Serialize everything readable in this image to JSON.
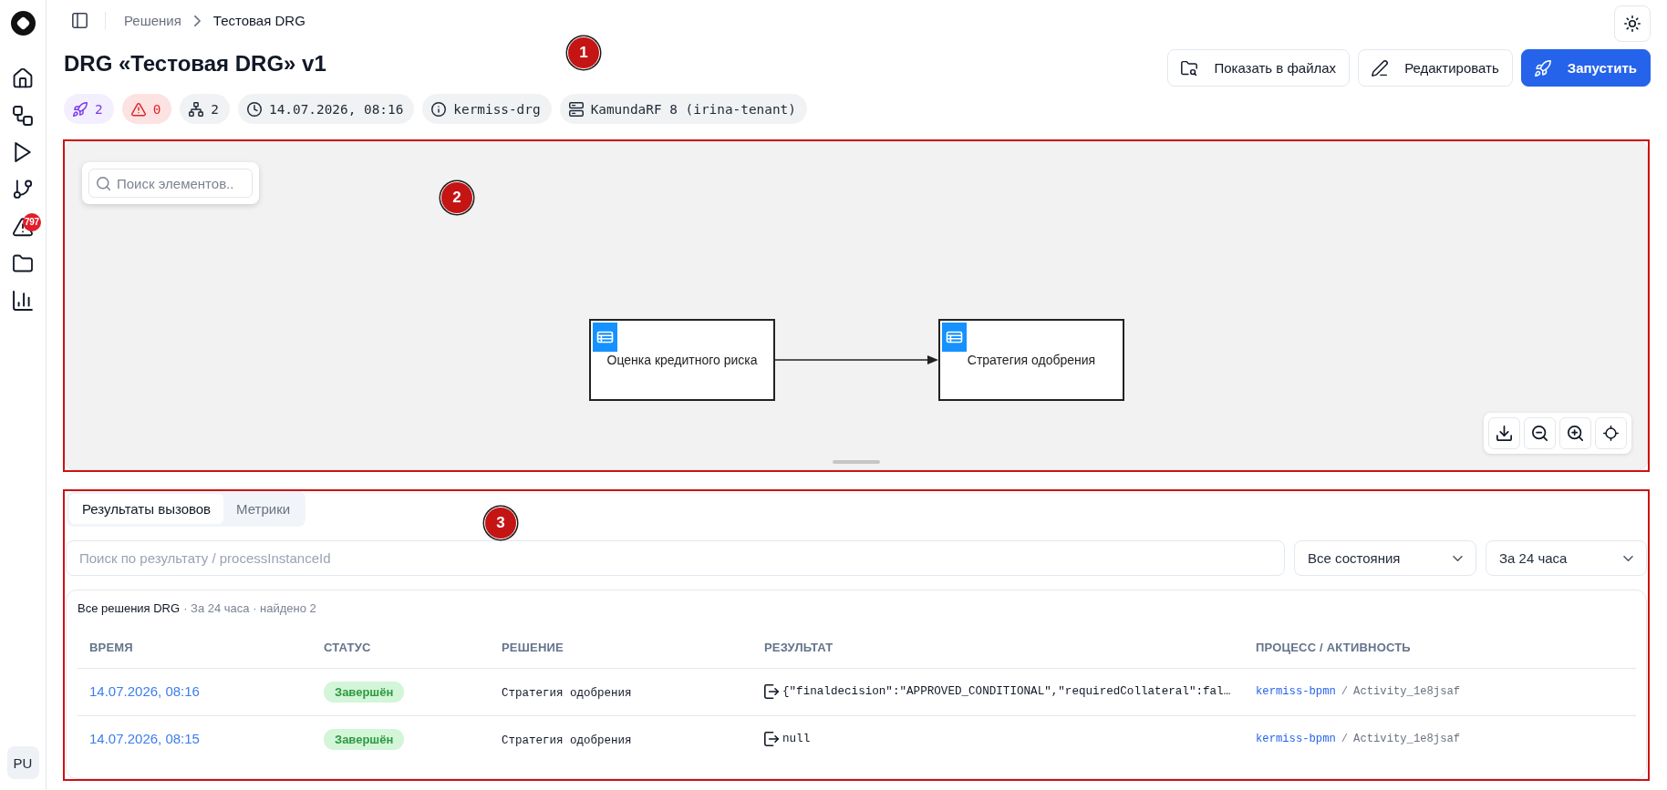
{
  "sidebar": {
    "items": [
      {
        "kind": "home",
        "selected": false
      },
      {
        "kind": "flows",
        "selected": false
      },
      {
        "kind": "run",
        "selected": false
      },
      {
        "kind": "branches",
        "selected": false
      },
      {
        "kind": "alerts",
        "selected": false,
        "badge": "797"
      },
      {
        "kind": "files",
        "selected": false
      },
      {
        "kind": "stats",
        "selected": false
      }
    ],
    "user": {
      "initials": "PU"
    }
  },
  "breadcrumb": [
    {
      "label": "Решения",
      "current": false
    },
    {
      "label": "Тестовая DRG",
      "current": true
    }
  ],
  "header": {
    "marker": "1",
    "title": "DRG «Тестовая DRG» v1",
    "actions": [
      {
        "kind": "files",
        "label": "Показать в файлах",
        "primary": false
      },
      {
        "kind": "edit",
        "label": "Редактировать",
        "primary": false
      },
      {
        "kind": "launch",
        "label": "Запустить",
        "primary": true
      }
    ],
    "chips": [
      {
        "kind": "launches",
        "text": "2"
      },
      {
        "kind": "errors",
        "text": "0"
      },
      {
        "kind": "nodes",
        "text": "2"
      },
      {
        "kind": "date",
        "text": "14.07.2026, 08:16"
      },
      {
        "kind": "key",
        "text": "kermiss-drg"
      },
      {
        "kind": "engine",
        "text": "KamundaRF 8 (irina-tenant)"
      }
    ]
  },
  "canvas": {
    "framed": true,
    "marker": "2",
    "search": {
      "placeholder": "Поиск элементов.."
    },
    "nodes": [
      {
        "label": "Оценка кредитного риска",
        "outgoing": true
      },
      {
        "label": "Стратегия одобрения",
        "outgoing": false
      }
    ]
  },
  "results": {
    "framed": true,
    "marker": "3",
    "tabs": [
      {
        "label": "Результаты вызовов",
        "selected": true
      },
      {
        "label": "Метрики",
        "selected": false
      }
    ],
    "search": {
      "placeholder": "Поиск по результату / processInstanceId"
    },
    "filters": [
      {
        "value": "Все состояния"
      },
      {
        "value": "За 24 часа"
      }
    ],
    "summary": {
      "title": "Все решения DRG",
      "meta": "· За 24 часа · найдено 2"
    },
    "table": {
      "columns": [
        "ВРЕМЯ",
        "СТАТУС",
        "РЕШЕНИЕ",
        "РЕЗУЛЬТАТ",
        "ПРОЦЕСС / АКТИВНОСТЬ"
      ],
      "rows": [
        {
          "time": "14.07.2026, 08:16",
          "status": {
            "label": "Завершён",
            "kind": "success"
          },
          "decision": "Стратегия одобрения",
          "result": "{\"finaldecision\":\"APPROVED_CONDITIONAL\",\"requiredCollateral\":fal…",
          "process": "kermiss-bpmn",
          "separator": "/",
          "activity": "Activity_1e8jsaf"
        },
        {
          "time": "14.07.2026, 08:15",
          "status": {
            "label": "Завершён",
            "kind": "success"
          },
          "decision": "Стратегия одобрения",
          "result": "null",
          "process": "kermiss-bpmn",
          "separator": "/",
          "activity": "Activity_1e8jsaf"
        }
      ]
    }
  }
}
